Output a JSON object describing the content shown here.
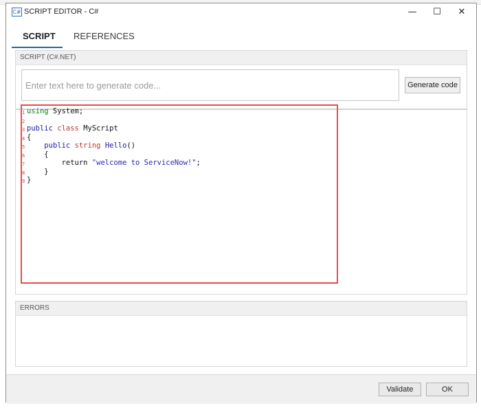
{
  "window": {
    "title": "SCRIPT EDITOR - C#",
    "app_icon": "C#",
    "controls": {
      "minimize": "—",
      "maximize": "☐",
      "close": "✕"
    }
  },
  "tabs": [
    {
      "label": "SCRIPT",
      "active": true
    },
    {
      "label": "REFERENCES",
      "active": false
    }
  ],
  "script_panel": {
    "header": "SCRIPT (C#.NET)",
    "generate_input_placeholder": "Enter text here to generate code...",
    "generate_button": "Generate code"
  },
  "editor": {
    "line_numbers": [
      "1",
      "2",
      "3",
      "4",
      "5",
      "6",
      "7",
      "8",
      "9"
    ],
    "lines": [
      [
        {
          "t": "using",
          "c": "kw"
        },
        {
          "t": " System;",
          "c": ""
        }
      ],
      [],
      [
        {
          "t": "public",
          "c": "kw-blue"
        },
        {
          "t": " ",
          "c": ""
        },
        {
          "t": "class",
          "c": "kw-red"
        },
        {
          "t": " MyScript",
          "c": ""
        }
      ],
      [
        {
          "t": "{",
          "c": ""
        }
      ],
      [
        {
          "t": "    ",
          "c": ""
        },
        {
          "t": "public",
          "c": "kw-blue"
        },
        {
          "t": " ",
          "c": ""
        },
        {
          "t": "string",
          "c": "kw-red"
        },
        {
          "t": " ",
          "c": ""
        },
        {
          "t": "Hello",
          "c": "kw-blue"
        },
        {
          "t": "()",
          "c": ""
        }
      ],
      [
        {
          "t": "    {",
          "c": ""
        }
      ],
      [
        {
          "t": "        return ",
          "c": ""
        },
        {
          "t": "\"welcome to ServiceNow!\"",
          "c": "str"
        },
        {
          "t": ";",
          "c": ""
        }
      ],
      [
        {
          "t": "    }",
          "c": ""
        }
      ],
      [
        {
          "t": "}",
          "c": ""
        }
      ]
    ]
  },
  "errors_panel": {
    "header": "ERRORS"
  },
  "footer": {
    "validate_button": "Validate",
    "ok_button": "OK"
  },
  "colors": {
    "tab_underline": "#1b6b9a",
    "highlight_border": "#e24e4e"
  }
}
